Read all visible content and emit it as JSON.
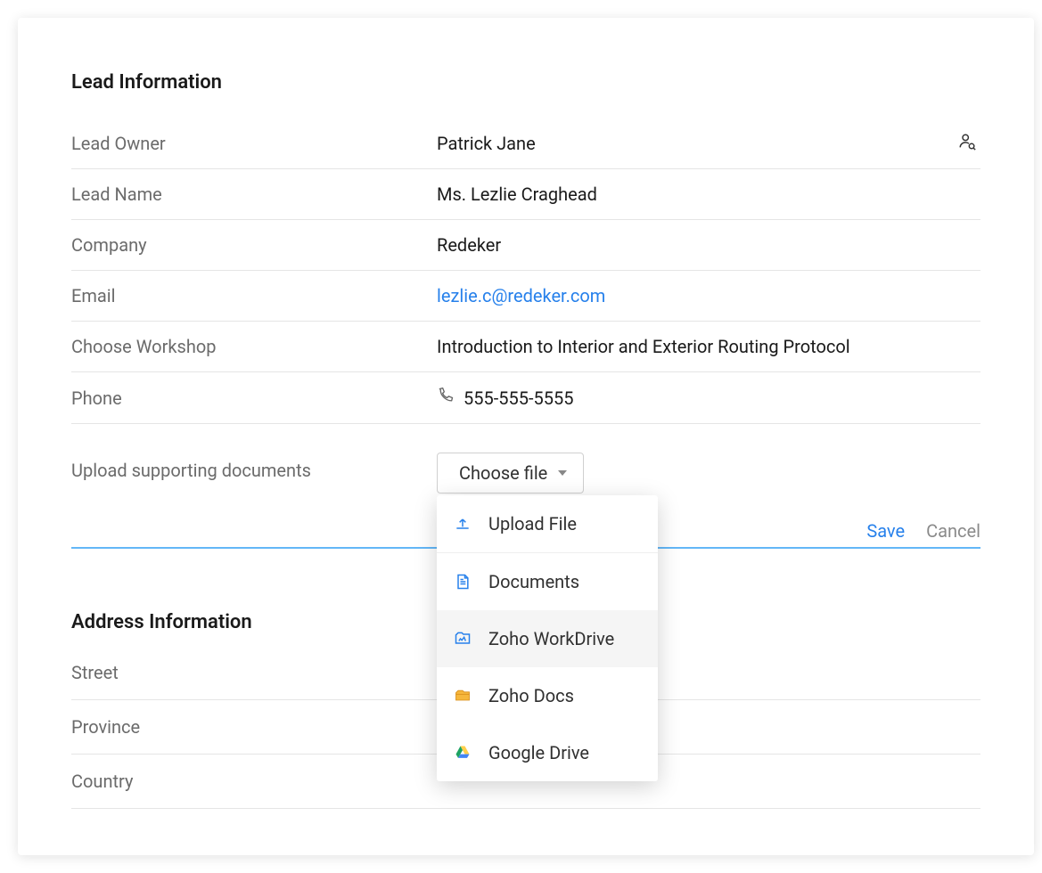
{
  "sections": {
    "lead": {
      "title": "Lead Information",
      "fields": {
        "owner_label": "Lead Owner",
        "owner_value": "Patrick Jane",
        "name_label": "Lead Name",
        "name_value": "Ms. Lezlie Craghead",
        "company_label": "Company",
        "company_value": "Redeker",
        "email_label": "Email",
        "email_value": "lezlie.c@redeker.com",
        "workshop_label": "Choose Workshop",
        "workshop_value": "Introduction to Interior and Exterior Routing Protocol",
        "phone_label": "Phone",
        "phone_value": "555-555-5555",
        "upload_label": "Upload supporting documents"
      }
    },
    "address": {
      "title": "Address Information",
      "street_label": "Street",
      "province_label": "Province",
      "country_label": "Country"
    }
  },
  "choose_file": {
    "button_label": "Choose file",
    "options": [
      {
        "label": "Upload File",
        "icon": "upload-icon"
      },
      {
        "label": "Documents",
        "icon": "document-icon"
      },
      {
        "label": "Zoho WorkDrive",
        "icon": "workdrive-icon"
      },
      {
        "label": "Zoho Docs",
        "icon": "zohodocs-icon"
      },
      {
        "label": "Google Drive",
        "icon": "gdrive-icon"
      }
    ]
  },
  "actions": {
    "save": "Save",
    "cancel": "Cancel"
  }
}
